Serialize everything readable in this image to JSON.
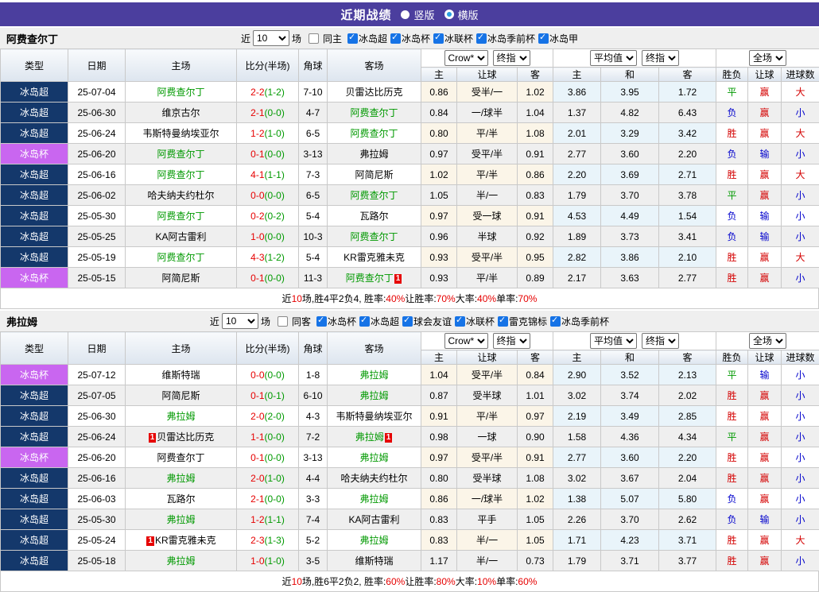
{
  "header": {
    "title": "近期战绩",
    "radio_vertical": "竖版",
    "radio_horizontal": "横版"
  },
  "colors": {
    "titlebar_bg": "#4b3e9e",
    "league_super": "#14386b",
    "league_cup": "#c966f0",
    "team_green": "#009900",
    "score_red": "#e60000",
    "half_green": "#009900",
    "badge_red": "#e60000",
    "summary_red": "#e60000",
    "result_red": "#d40000",
    "result_green": "#009900",
    "result_blue": "#0000cc"
  },
  "result_color_map": {
    "胜": "result_red",
    "赢": "result_red",
    "大": "result_red",
    "平": "result_green",
    "负": "result_blue",
    "输": "result_blue",
    "小": "result_blue"
  },
  "tableHeader": {
    "cols": {
      "type": "类型",
      "date": "日期",
      "home": "主场",
      "score": "比分(半场)",
      "corner": "角球",
      "away": "客场"
    },
    "crow_select": "Crow*",
    "final_select_1": "终指",
    "avg_select": "平均值",
    "final_select_2": "终指",
    "scope_select": "全场",
    "sub": {
      "h": "主",
      "hc": "让球",
      "a": "客",
      "mh": "主",
      "md": "和",
      "ma": "客",
      "res": "胜负",
      "rhc": "让球",
      "goals": "进球数"
    }
  },
  "sections": [
    {
      "team": "阿费查尔丁",
      "filter": {
        "near": "近",
        "count": "10",
        "games": "场",
        "same": "同主",
        "leagues": [
          "冰岛超",
          "冰岛杯",
          "冰联杯",
          "冰岛季前杯",
          "冰岛甲"
        ]
      },
      "rows": [
        {
          "league": "冰岛超",
          "date": "25-07-04",
          "home": "阿费查尔丁",
          "home_green": true,
          "score": "2-2",
          "half": "(1-2)",
          "corner": "7-10",
          "away": "贝雷达比历克",
          "away_green": false,
          "crow": [
            "0.86",
            "受半/一",
            "1.02"
          ],
          "avg": [
            "3.86",
            "3.95",
            "1.72"
          ],
          "outcome": [
            "平",
            "赢",
            "大"
          ]
        },
        {
          "league": "冰岛超",
          "date": "25-06-30",
          "home": "维京古尔",
          "home_green": false,
          "score": "2-1",
          "half": "(0-0)",
          "corner": "4-7",
          "away": "阿费查尔丁",
          "away_green": true,
          "crow": [
            "0.84",
            "一/球半",
            "1.04"
          ],
          "avg": [
            "1.37",
            "4.82",
            "6.43"
          ],
          "outcome": [
            "负",
            "赢",
            "小"
          ]
        },
        {
          "league": "冰岛超",
          "date": "25-06-24",
          "home": "韦斯特曼纳埃亚尔",
          "home_green": false,
          "score": "1-2",
          "half": "(1-0)",
          "corner": "6-5",
          "away": "阿费查尔丁",
          "away_green": true,
          "crow": [
            "0.80",
            "平/半",
            "1.08"
          ],
          "avg": [
            "2.01",
            "3.29",
            "3.42"
          ],
          "outcome": [
            "胜",
            "赢",
            "大"
          ]
        },
        {
          "league": "冰岛杯",
          "date": "25-06-20",
          "home": "阿费查尔丁",
          "home_green": true,
          "score": "0-1",
          "half": "(0-0)",
          "corner": "3-13",
          "away": "弗拉姆",
          "away_green": false,
          "crow": [
            "0.97",
            "受平/半",
            "0.91"
          ],
          "avg": [
            "2.77",
            "3.60",
            "2.20"
          ],
          "outcome": [
            "负",
            "输",
            "小"
          ]
        },
        {
          "league": "冰岛超",
          "date": "25-06-16",
          "home": "阿费查尔丁",
          "home_green": true,
          "score": "4-1",
          "half": "(1-1)",
          "corner": "7-3",
          "away": "阿简尼斯",
          "away_green": false,
          "crow": [
            "1.02",
            "平/半",
            "0.86"
          ],
          "avg": [
            "2.20",
            "3.69",
            "2.71"
          ],
          "outcome": [
            "胜",
            "赢",
            "大"
          ]
        },
        {
          "league": "冰岛超",
          "date": "25-06-02",
          "home": "哈夫纳夫约杜尔",
          "home_green": false,
          "score": "0-0",
          "half": "(0-0)",
          "corner": "6-5",
          "away": "阿费查尔丁",
          "away_green": true,
          "crow": [
            "1.05",
            "半/一",
            "0.83"
          ],
          "avg": [
            "1.79",
            "3.70",
            "3.78"
          ],
          "outcome": [
            "平",
            "赢",
            "小"
          ]
        },
        {
          "league": "冰岛超",
          "date": "25-05-30",
          "home": "阿费查尔丁",
          "home_green": true,
          "score": "0-2",
          "half": "(0-2)",
          "corner": "5-4",
          "away": "瓦路尔",
          "away_green": false,
          "crow": [
            "0.97",
            "受一球",
            "0.91"
          ],
          "avg": [
            "4.53",
            "4.49",
            "1.54"
          ],
          "outcome": [
            "负",
            "输",
            "小"
          ]
        },
        {
          "league": "冰岛超",
          "date": "25-05-25",
          "home": "KA阿古雷利",
          "home_green": false,
          "score": "1-0",
          "half": "(0-0)",
          "corner": "10-3",
          "away": "阿费查尔丁",
          "away_green": true,
          "crow": [
            "0.96",
            "半球",
            "0.92"
          ],
          "avg": [
            "1.89",
            "3.73",
            "3.41"
          ],
          "outcome": [
            "负",
            "输",
            "小"
          ]
        },
        {
          "league": "冰岛超",
          "date": "25-05-19",
          "home": "阿费查尔丁",
          "home_green": true,
          "score": "4-3",
          "half": "(1-2)",
          "corner": "5-4",
          "away": "KR雷克雅未克",
          "away_green": false,
          "crow": [
            "0.93",
            "受平/半",
            "0.95"
          ],
          "avg": [
            "2.82",
            "3.86",
            "2.10"
          ],
          "outcome": [
            "胜",
            "赢",
            "大"
          ]
        },
        {
          "league": "冰岛杯",
          "date": "25-05-15",
          "home": "阿简尼斯",
          "home_green": false,
          "score": "0-1",
          "half": "(0-0)",
          "corner": "11-3",
          "away": "阿费查尔丁",
          "away_green": true,
          "away_badge_after": "1",
          "crow": [
            "0.93",
            "平/半",
            "0.89"
          ],
          "avg": [
            "2.17",
            "3.63",
            "2.77"
          ],
          "outcome": [
            "胜",
            "赢",
            "小"
          ]
        }
      ],
      "summary": [
        {
          "t": "近"
        },
        {
          "t": "10",
          "red": true
        },
        {
          "t": "场,胜4平2负4, 胜率:"
        },
        {
          "t": "40%",
          "red": true
        },
        {
          "t": " 让胜率:"
        },
        {
          "t": "70%",
          "red": true
        },
        {
          "t": " 大率:"
        },
        {
          "t": "40%",
          "red": true
        },
        {
          "t": " 单率:"
        },
        {
          "t": "70%",
          "red": true
        }
      ]
    },
    {
      "team": "弗拉姆",
      "filter": {
        "near": "近",
        "count": "10",
        "games": "场",
        "same": "同客",
        "leagues": [
          "冰岛杯",
          "冰岛超",
          "球会友谊",
          "冰联杯",
          "雷克锦标",
          "冰岛季前杯"
        ]
      },
      "rows": [
        {
          "league": "冰岛杯",
          "date": "25-07-12",
          "home": "维斯特瑞",
          "home_green": false,
          "score": "0-0",
          "half": "(0-0)",
          "corner": "1-8",
          "away": "弗拉姆",
          "away_green": true,
          "crow": [
            "1.04",
            "受平/半",
            "0.84"
          ],
          "avg": [
            "2.90",
            "3.52",
            "2.13"
          ],
          "outcome": [
            "平",
            "输",
            "小"
          ]
        },
        {
          "league": "冰岛超",
          "date": "25-07-05",
          "home": "阿简尼斯",
          "home_green": false,
          "score": "0-1",
          "half": "(0-1)",
          "corner": "6-10",
          "away": "弗拉姆",
          "away_green": true,
          "crow": [
            "0.87",
            "受半球",
            "1.01"
          ],
          "avg": [
            "3.02",
            "3.74",
            "2.02"
          ],
          "outcome": [
            "胜",
            "赢",
            "小"
          ]
        },
        {
          "league": "冰岛超",
          "date": "25-06-30",
          "home": "弗拉姆",
          "home_green": true,
          "score": "2-0",
          "half": "(2-0)",
          "corner": "4-3",
          "away": "韦斯特曼纳埃亚尔",
          "away_green": false,
          "crow": [
            "0.91",
            "平/半",
            "0.97"
          ],
          "avg": [
            "2.19",
            "3.49",
            "2.85"
          ],
          "outcome": [
            "胜",
            "赢",
            "小"
          ]
        },
        {
          "league": "冰岛超",
          "date": "25-06-24",
          "home": "贝雷达比历克",
          "home_green": false,
          "home_badge_before": "1",
          "score": "1-1",
          "half": "(0-0)",
          "corner": "7-2",
          "away": "弗拉姆",
          "away_green": true,
          "away_badge_after": "1",
          "crow": [
            "0.98",
            "一球",
            "0.90"
          ],
          "avg": [
            "1.58",
            "4.36",
            "4.34"
          ],
          "outcome": [
            "平",
            "赢",
            "小"
          ]
        },
        {
          "league": "冰岛杯",
          "date": "25-06-20",
          "home": "阿费查尔丁",
          "home_green": false,
          "score": "0-1",
          "half": "(0-0)",
          "corner": "3-13",
          "away": "弗拉姆",
          "away_green": true,
          "crow": [
            "0.97",
            "受平/半",
            "0.91"
          ],
          "avg": [
            "2.77",
            "3.60",
            "2.20"
          ],
          "outcome": [
            "胜",
            "赢",
            "小"
          ]
        },
        {
          "league": "冰岛超",
          "date": "25-06-16",
          "home": "弗拉姆",
          "home_green": true,
          "score": "2-0",
          "half": "(1-0)",
          "corner": "4-4",
          "away": "哈夫纳夫约杜尔",
          "away_green": false,
          "crow": [
            "0.80",
            "受半球",
            "1.08"
          ],
          "avg": [
            "3.02",
            "3.67",
            "2.04"
          ],
          "outcome": [
            "胜",
            "赢",
            "小"
          ]
        },
        {
          "league": "冰岛超",
          "date": "25-06-03",
          "home": "瓦路尔",
          "home_green": false,
          "score": "2-1",
          "half": "(0-0)",
          "corner": "3-3",
          "away": "弗拉姆",
          "away_green": true,
          "crow": [
            "0.86",
            "一/球半",
            "1.02"
          ],
          "avg": [
            "1.38",
            "5.07",
            "5.80"
          ],
          "outcome": [
            "负",
            "赢",
            "小"
          ]
        },
        {
          "league": "冰岛超",
          "date": "25-05-30",
          "home": "弗拉姆",
          "home_green": true,
          "score": "1-2",
          "half": "(1-1)",
          "corner": "7-4",
          "away": "KA阿古雷利",
          "away_green": false,
          "crow": [
            "0.83",
            "平手",
            "1.05"
          ],
          "avg": [
            "2.26",
            "3.70",
            "2.62"
          ],
          "outcome": [
            "负",
            "输",
            "小"
          ]
        },
        {
          "league": "冰岛超",
          "date": "25-05-24",
          "home": "KR雷克雅未克",
          "home_green": false,
          "home_badge_before": "1",
          "score": "2-3",
          "half": "(1-3)",
          "corner": "5-2",
          "away": "弗拉姆",
          "away_green": true,
          "crow": [
            "0.83",
            "半/一",
            "1.05"
          ],
          "avg": [
            "1.71",
            "4.23",
            "3.71"
          ],
          "outcome": [
            "胜",
            "赢",
            "大"
          ]
        },
        {
          "league": "冰岛超",
          "date": "25-05-18",
          "home": "弗拉姆",
          "home_green": true,
          "score": "1-0",
          "half": "(1-0)",
          "corner": "3-5",
          "away": "维斯特瑞",
          "away_green": false,
          "crow": [
            "1.17",
            "半/一",
            "0.73"
          ],
          "avg": [
            "1.79",
            "3.71",
            "3.77"
          ],
          "outcome": [
            "胜",
            "赢",
            "小"
          ]
        }
      ],
      "summary": [
        {
          "t": "近"
        },
        {
          "t": "10",
          "red": true
        },
        {
          "t": "场,胜6平2负2, 胜率:"
        },
        {
          "t": "60%",
          "red": true
        },
        {
          "t": " 让胜率:"
        },
        {
          "t": "80%",
          "red": true
        },
        {
          "t": " 大率:"
        },
        {
          "t": "10%",
          "red": true
        },
        {
          "t": " 单率:"
        },
        {
          "t": "60%",
          "red": true
        }
      ]
    }
  ]
}
